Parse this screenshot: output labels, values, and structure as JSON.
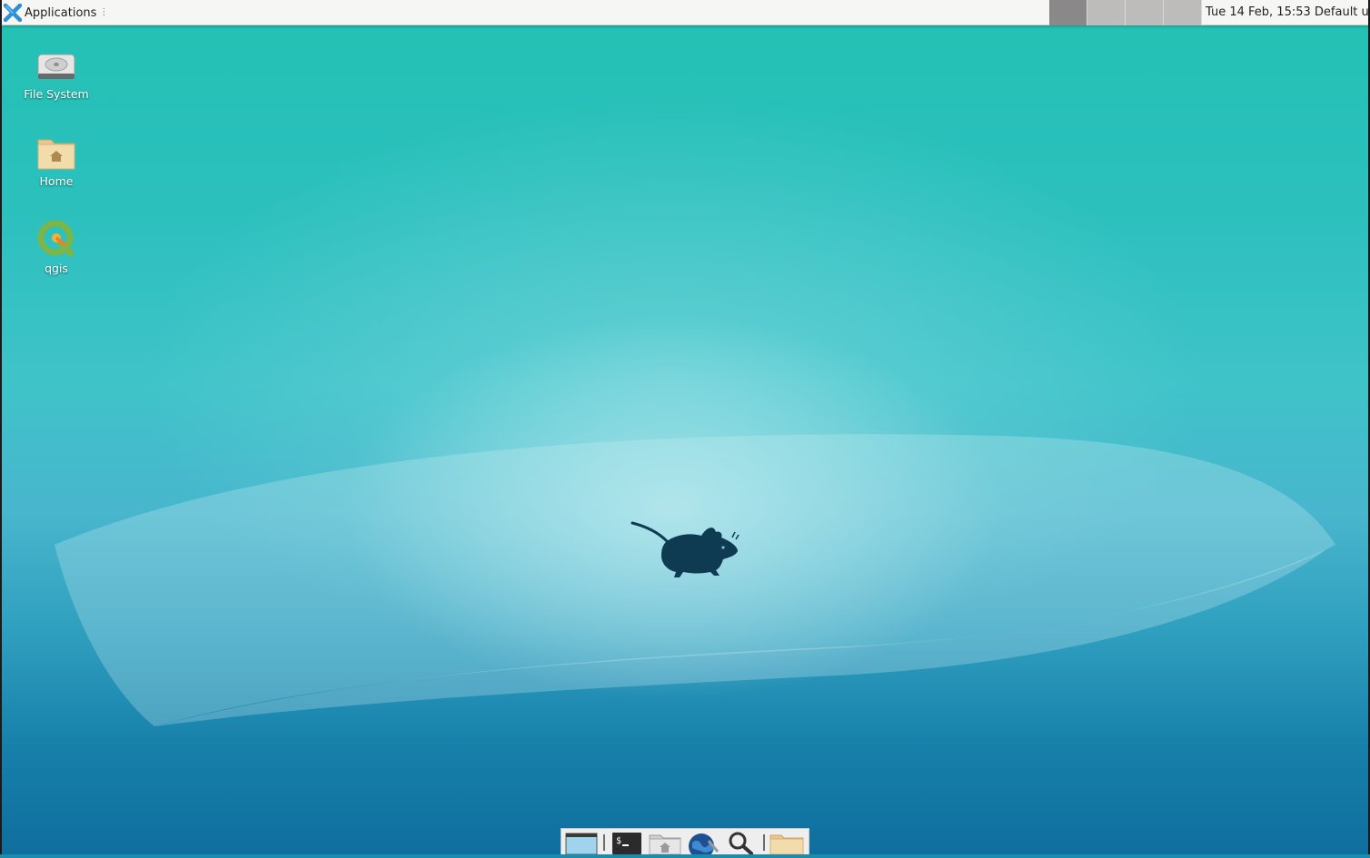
{
  "panel": {
    "applications_label": "Applications",
    "workspace_count": 4,
    "active_workspace": 1,
    "clock": "Tue 14 Feb, 15:53",
    "user": "Default user"
  },
  "desktop": {
    "icons": [
      {
        "label": "File System",
        "icon": "drive-harddisk-icon"
      },
      {
        "label": "Home",
        "icon": "home-folder-icon"
      },
      {
        "label": "qgis",
        "icon": "qgis-icon"
      }
    ]
  },
  "dock": {
    "items": [
      {
        "icon": "show-desktop-icon"
      },
      {
        "icon": "terminal-icon"
      },
      {
        "icon": "file-manager-icon"
      },
      {
        "icon": "web-browser-icon"
      },
      {
        "icon": "app-finder-icon"
      },
      {
        "icon": "folder-icon"
      }
    ]
  },
  "colors": {
    "panel_bg": "#f6f6f5",
    "desktop_top": "#22c1b3",
    "desktop_bottom": "#0f6e9e",
    "mouse_logo": "#0f3b52"
  }
}
